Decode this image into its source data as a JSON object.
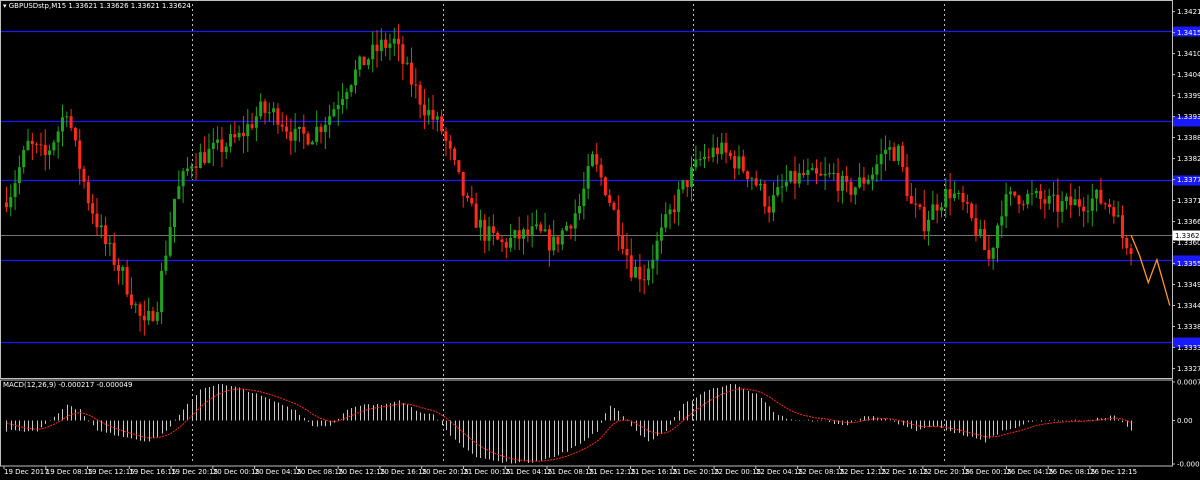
{
  "window": {
    "title_prefix": "▾",
    "symbol": "GBPUSDstp,M15",
    "ohlc": "1.33621 1.33626 1.33621 1.33624"
  },
  "macd": {
    "title": "MACD(12,26,9) -0.000217 -0.000049"
  },
  "colors": {
    "background": "#000000",
    "bull": "#1fa31f",
    "bear": "#ff2a1a",
    "level_line": "#1a1aff",
    "grid": "#c0c0c0",
    "projection": "#ff9a1f",
    "macd_hist": "#c8c8c8",
    "macd_signal": "#ff2a1a",
    "axis": "#c0c0c0",
    "text": "#ffffff"
  },
  "chart_data": [
    {
      "type": "candlestick",
      "title": "GBPUSDstp,M15 1.33621 1.33626 1.33621 1.33624",
      "ylim": [
        1.3325,
        1.3423
      ],
      "y_ticks": [
        "1.34210",
        "1.34155",
        "1.34100",
        "1.34045",
        "1.33990",
        "1.33935",
        "1.33880",
        "1.33825",
        "1.33770",
        "1.33715",
        "1.33660",
        "1.33605",
        "1.33550",
        "1.33495",
        "1.33440",
        "1.33385",
        "1.33330",
        "1.33275"
      ],
      "current_price": "1.33624",
      "x_labels": [
        "19 Dec 2017",
        "19 Dec 08:15",
        "19 Dec 12:15",
        "19 Dec 16:15",
        "19 Dec 20:15",
        "20 Dec 00:15",
        "20 Dec 04:15",
        "20 Dec 08:15",
        "20 Dec 12:15",
        "20 Dec 16:15",
        "20 Dec 20:15",
        "21 Dec 00:15",
        "21 Dec 04:15",
        "21 Dec 08:15",
        "21 Dec 12:15",
        "21 Dec 16:15",
        "21 Dec 20:15",
        "22 Dec 00:15",
        "22 Dec 04:15",
        "22 Dec 08:15",
        "22 Dec 12:15",
        "22 Dec 16:15",
        "22 Dec 20:15",
        "26 Dec 00:15",
        "26 Dec 04:15",
        "26 Dec 08:15",
        "26 Dec 12:15"
      ],
      "day_separator_after_label": [
        4,
        10,
        16,
        22
      ],
      "price_path": [
        [
          0,
          1.3371
        ],
        [
          2,
          1.3374
        ],
        [
          6,
          1.3386
        ],
        [
          10,
          1.3383
        ],
        [
          13,
          1.339
        ],
        [
          15,
          1.3396
        ],
        [
          17,
          1.3385
        ],
        [
          20,
          1.3372
        ],
        [
          24,
          1.336
        ],
        [
          28,
          1.3352
        ],
        [
          33,
          1.3338
        ],
        [
          36,
          1.3345
        ],
        [
          40,
          1.3372
        ],
        [
          44,
          1.3382
        ],
        [
          50,
          1.3385
        ],
        [
          55,
          1.3388
        ],
        [
          60,
          1.3395
        ],
        [
          64,
          1.3394
        ],
        [
          68,
          1.3388
        ],
        [
          72,
          1.3389
        ],
        [
          76,
          1.3394
        ],
        [
          80,
          1.3402
        ],
        [
          84,
          1.3408
        ],
        [
          88,
          1.3412
        ],
        [
          91,
          1.3413
        ],
        [
          94,
          1.3405
        ],
        [
          98,
          1.3396
        ],
        [
          102,
          1.339
        ],
        [
          105,
          1.338
        ],
        [
          108,
          1.337
        ],
        [
          112,
          1.3363
        ],
        [
          116,
          1.336
        ],
        [
          120,
          1.3362
        ],
        [
          124,
          1.3363
        ],
        [
          128,
          1.336
        ],
        [
          131,
          1.3365
        ],
        [
          134,
          1.337
        ],
        [
          137,
          1.3382
        ],
        [
          140,
          1.3375
        ],
        [
          143,
          1.3365
        ],
        [
          146,
          1.3354
        ],
        [
          149,
          1.3352
        ],
        [
          152,
          1.336
        ],
        [
          155,
          1.3368
        ],
        [
          158,
          1.3375
        ],
        [
          162,
          1.3382
        ],
        [
          166,
          1.3385
        ],
        [
          170,
          1.3382
        ],
        [
          174,
          1.3378
        ],
        [
          178,
          1.337
        ],
        [
          182,
          1.3376
        ],
        [
          186,
          1.3378
        ],
        [
          190,
          1.3377
        ],
        [
          193,
          1.3378
        ],
        [
          196,
          1.3374
        ],
        [
          199,
          1.3376
        ],
        [
          202,
          1.3379
        ],
        [
          205,
          1.3385
        ],
        [
          208,
          1.3384
        ],
        [
          211,
          1.337
        ],
        [
          214,
          1.3366
        ],
        [
          217,
          1.3371
        ],
        [
          220,
          1.3374
        ],
        [
          223,
          1.337
        ],
        [
          226,
          1.3364
        ],
        [
          229,
          1.3356
        ],
        [
          232,
          1.337
        ],
        [
          235,
          1.3373
        ],
        [
          240,
          1.3372
        ],
        [
          245,
          1.337
        ],
        [
          250,
          1.3371
        ],
        [
          254,
          1.3372
        ],
        [
          258,
          1.337
        ],
        [
          260,
          1.3362
        ],
        [
          262,
          1.336
        ]
      ],
      "total_bars": 262,
      "horizontal_levels": [
        1.3416,
        1.33923,
        1.33768,
        1.33559,
        1.33345
      ],
      "current_price_value": 1.33624,
      "projection_path": [
        [
          262,
          1.33624
        ],
        [
          264,
          1.3357
        ],
        [
          266,
          1.335
        ],
        [
          268,
          1.3356
        ],
        [
          271,
          1.3344
        ]
      ]
    },
    {
      "type": "macd",
      "title": "MACD(12,26,9) -0.000217 -0.000049",
      "y_ticks": [
        "0.000736",
        "0.00",
        "-0.00083"
      ],
      "ylim": [
        -0.00083,
        0.000736
      ],
      "hist_path": [
        [
          0,
          -0.0002
        ],
        [
          8,
          -0.0002
        ],
        [
          15,
          0.0003
        ],
        [
          18,
          0.0002
        ],
        [
          22,
          -0.0002
        ],
        [
          28,
          -0.0003
        ],
        [
          34,
          -0.0004
        ],
        [
          38,
          -0.0002
        ],
        [
          42,
          0.0002
        ],
        [
          46,
          0.0006
        ],
        [
          50,
          0.0007
        ],
        [
          56,
          0.0006
        ],
        [
          62,
          0.0004
        ],
        [
          68,
          0.0002
        ],
        [
          72,
          -0.0001
        ],
        [
          76,
          -0.0001
        ],
        [
          80,
          0.0002
        ],
        [
          84,
          0.0003
        ],
        [
          88,
          0.0003
        ],
        [
          92,
          0.0004
        ],
        [
          96,
          0.0002
        ],
        [
          100,
          0.0001
        ],
        [
          104,
          -0.0003
        ],
        [
          110,
          -0.0007
        ],
        [
          116,
          -0.0008
        ],
        [
          122,
          -0.0008
        ],
        [
          128,
          -0.0007
        ],
        [
          133,
          -0.0005
        ],
        [
          138,
          -0.0002
        ],
        [
          141,
          0.0003
        ],
        [
          144,
          0.0001
        ],
        [
          147,
          -0.0002
        ],
        [
          150,
          -0.0004
        ],
        [
          154,
          -0.0002
        ],
        [
          158,
          0.0003
        ],
        [
          164,
          0.0006
        ],
        [
          170,
          0.0007
        ],
        [
          175,
          0.0005
        ],
        [
          180,
          0.0001
        ],
        [
          184,
          0.0
        ],
        [
          190,
          0.0
        ],
        [
          196,
          -0.0001
        ],
        [
          200,
          0.0001
        ],
        [
          206,
          0.0
        ],
        [
          212,
          -0.0002
        ],
        [
          216,
          -0.0001
        ],
        [
          220,
          -0.0002
        ],
        [
          224,
          -0.0003
        ],
        [
          228,
          -0.0004
        ],
        [
          232,
          -0.0002
        ],
        [
          236,
          -0.0001
        ],
        [
          240,
          0.0
        ],
        [
          246,
          0.0
        ],
        [
          252,
          0.0
        ],
        [
          258,
          0.0001
        ],
        [
          262,
          -0.0002
        ]
      ]
    }
  ]
}
